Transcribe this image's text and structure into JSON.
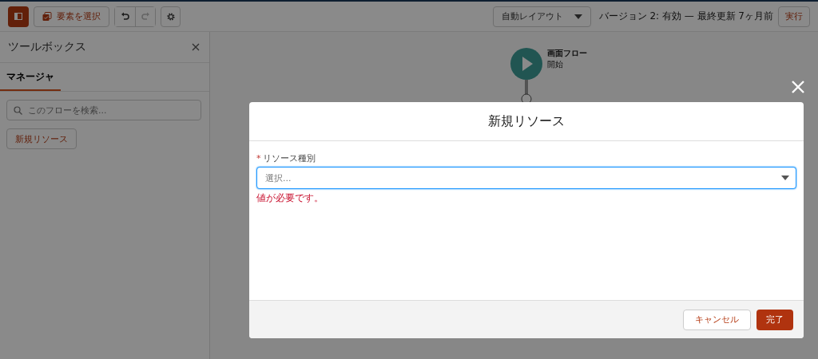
{
  "toolbar": {
    "select_button": "要素を選択",
    "history": [
      {
        "kind": "undo",
        "disabled": false
      },
      {
        "kind": "redo",
        "disabled": true
      }
    ],
    "layout_dropdown": "自動レイアウト",
    "version": "バージョン 2: 有効 — 最終更新 7ヶ月前",
    "run_button": "実行"
  },
  "sidebar": {
    "title": "ツールボックス",
    "tabs": [
      {
        "label": "マネージャ",
        "selected": true
      }
    ],
    "search": {
      "placeholder": "このフローを検索..."
    },
    "new_resource_button": "新規リソース"
  },
  "canvas": {
    "start_node": {
      "title": "画面フロー",
      "subtitle": "開始"
    }
  },
  "modal": {
    "title": "新規リソース",
    "field": {
      "label": "リソース種別",
      "required_mark": "*",
      "placeholder": "選択...",
      "error": "値が必要です。"
    },
    "cancel_button": "キャンセル",
    "done_button": "完了"
  }
}
